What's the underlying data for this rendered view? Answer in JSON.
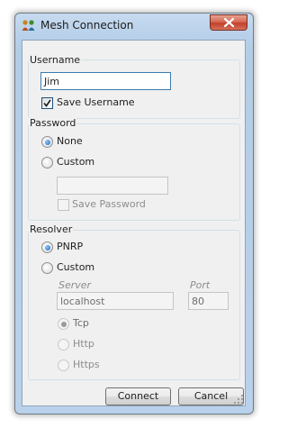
{
  "window": {
    "title": "Mesh Connection"
  },
  "username": {
    "group_label": "Username",
    "value": "Jim",
    "save_label": "Save Username",
    "save_checked": true
  },
  "password": {
    "group_label": "Password",
    "none_label": "None",
    "custom_label": "Custom",
    "selected": "None",
    "value": "",
    "save_label": "Save Password",
    "save_checked": false
  },
  "resolver": {
    "group_label": "Resolver",
    "pnrp_label": "PNRP",
    "custom_label": "Custom",
    "selected": "PNRP",
    "server_label": "Server",
    "server_value": "localhost",
    "port_label": "Port",
    "port_value": "80",
    "protocols": [
      "Tcp",
      "Http",
      "Https"
    ],
    "selected_protocol": "Tcp"
  },
  "buttons": {
    "connect": "Connect",
    "cancel": "Cancel"
  }
}
